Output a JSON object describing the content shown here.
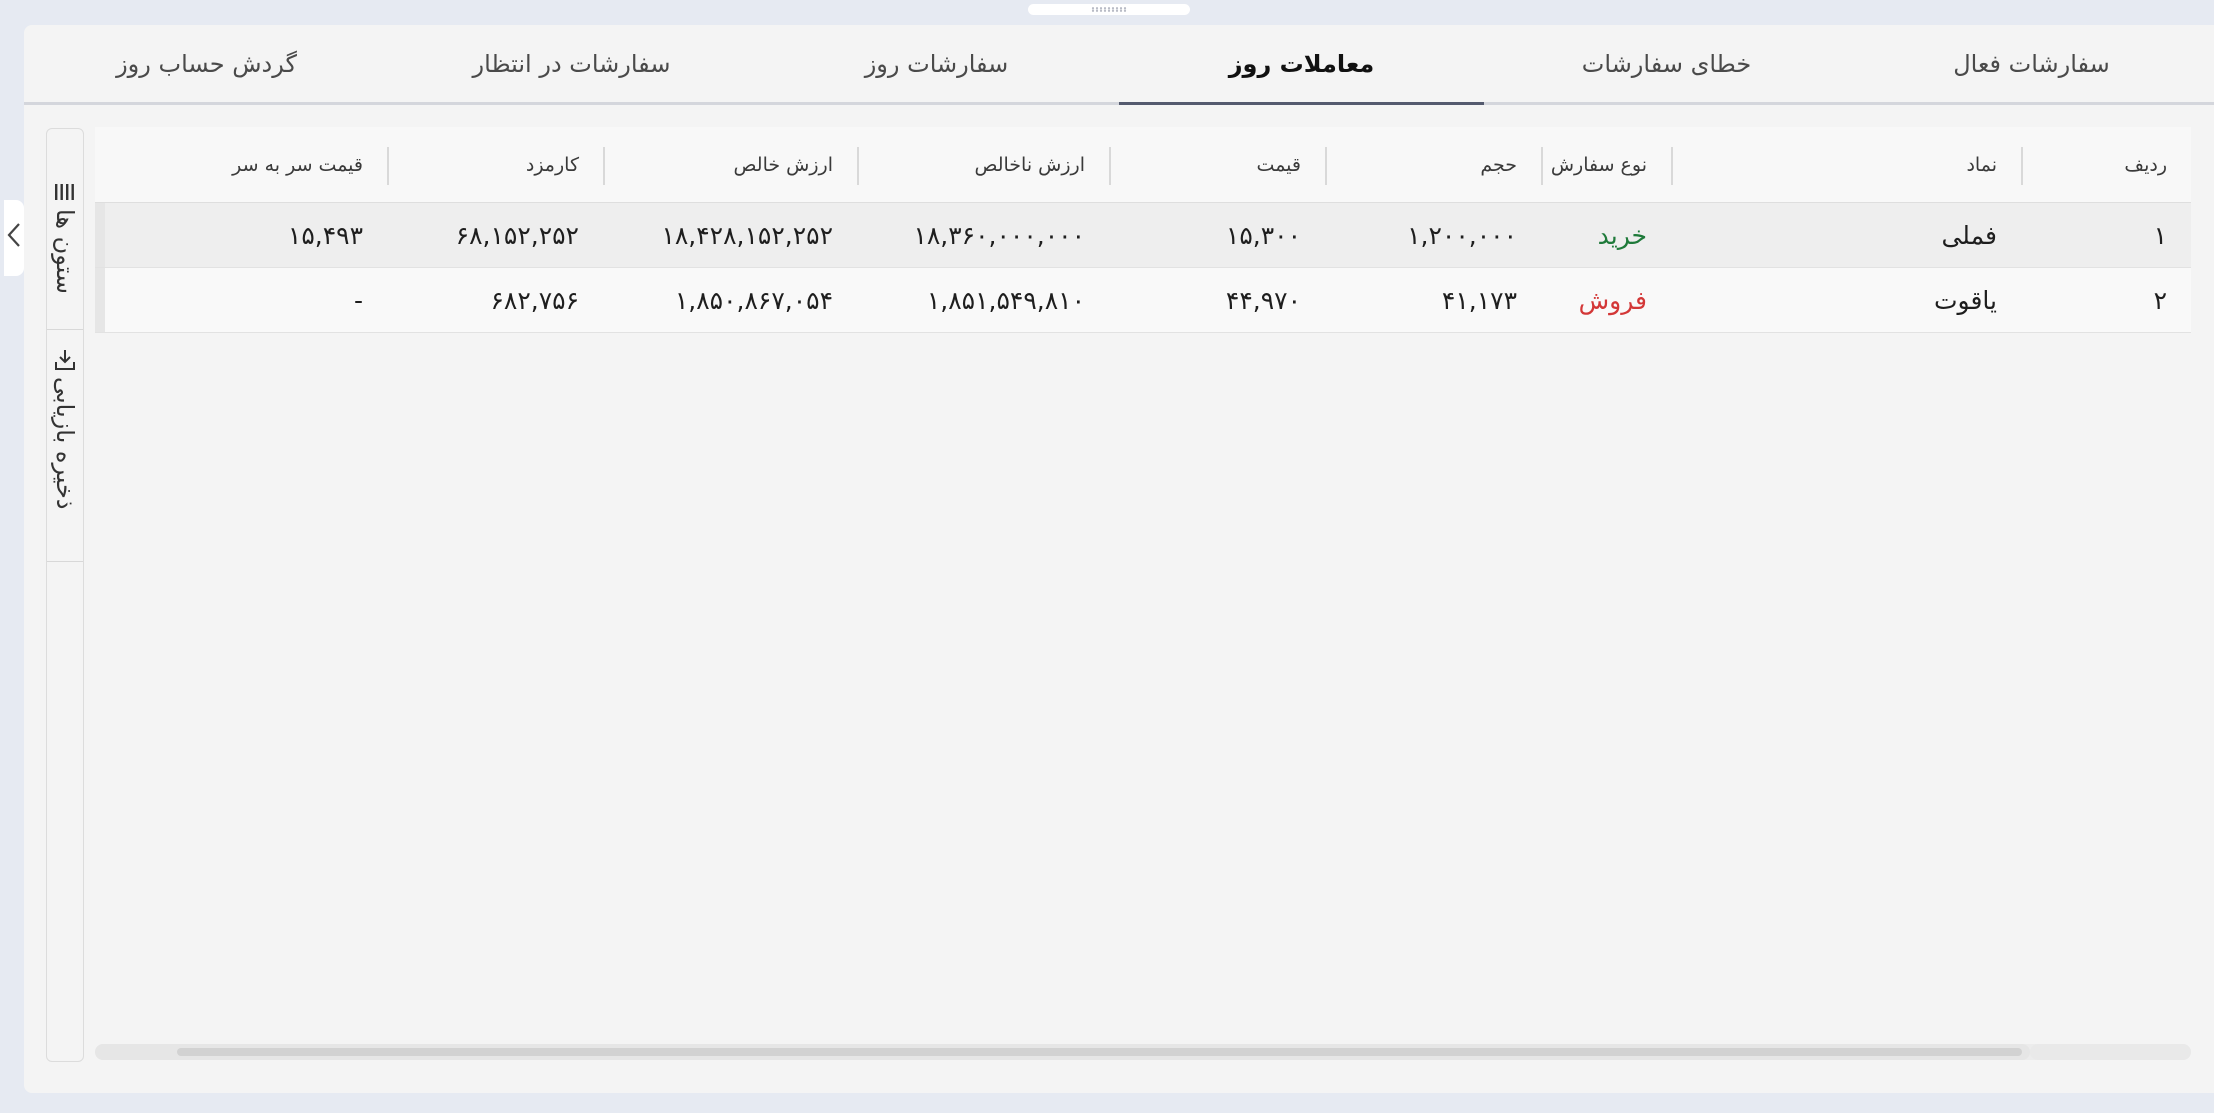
{
  "tabs": [
    {
      "label": "سفارشات فعال"
    },
    {
      "label": "خطای سفارشات"
    },
    {
      "label": "معاملات روز"
    },
    {
      "label": "سفارشات روز"
    },
    {
      "label": "سفارشات در انتظار"
    },
    {
      "label": "گردش حساب روز"
    }
  ],
  "active_tab": "معاملات روز",
  "toolbar": {
    "columns_label": "ستون ها",
    "columns_icon": "columns-icon",
    "save_label": "ذخیره بازیابی",
    "save_icon": "download-icon"
  },
  "table": {
    "columns": [
      "ردیف",
      "نماد",
      "نوع سفارش",
      "حجم",
      "قیمت",
      "ارزش ناخالص",
      "ارزش خالص",
      "کارمزد",
      "قیمت سر به سر"
    ],
    "rows": [
      {
        "row": "۱",
        "symbol": "فملی",
        "side": "خرید",
        "volume": "۱,۲۰۰,۰۰۰",
        "price": "۱۵,۳۰۰",
        "gross": "۱۸,۳۶۰,۰۰۰,۰۰۰",
        "net": "۱۸,۴۲۸,۱۵۲,۲۵۲",
        "fee": "۶۸,۱۵۲,۲۵۲",
        "breakeven": "۱۵,۴۹۳"
      },
      {
        "row": "۲",
        "symbol": "یاقوت",
        "side": "فروش",
        "volume": "۴۱,۱۷۳",
        "price": "۴۴,۹۷۰",
        "gross": "۱,۸۵۱,۵۴۹,۸۱۰",
        "net": "۱,۸۵۰,۸۶۷,۰۵۴",
        "fee": "۶۸۲,۷۵۶",
        "breakeven": "-"
      }
    ]
  },
  "colors": {
    "buy": "#1f7a3a",
    "sell": "#d33737",
    "active_tab_underline": "#545a6e"
  }
}
